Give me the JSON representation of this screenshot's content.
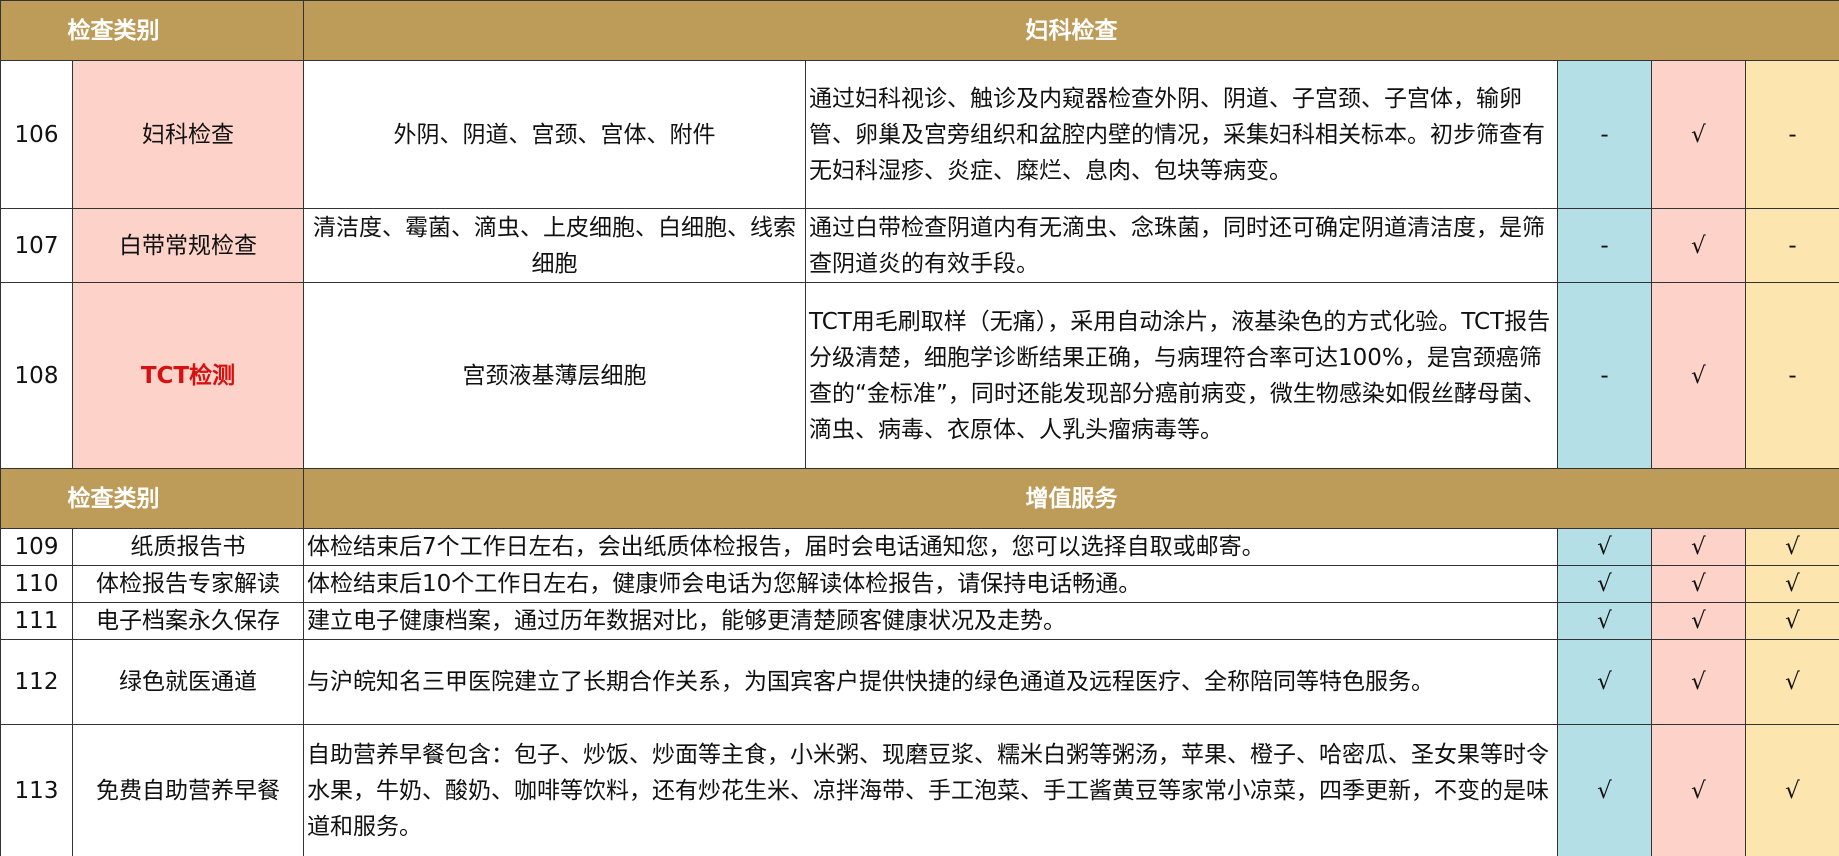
{
  "section1": {
    "category_label": "检查类别",
    "title": "妇科检查",
    "rows": [
      {
        "num": "106",
        "name": "妇科检查",
        "items": "外阴、阴道、宫颈、宫体、附件",
        "desc": "通过妇科视诊、触诊及内窥器检查外阴、阴道、子宫颈、子宫体，输卵管、卵巢及宫旁组织和盆腔内壁的情况，采集妇科相关标本。初步筛查有无妇科湿疹、炎症、糜烂、息肉、包块等病变。",
        "c1": "-",
        "c2": "√",
        "c3": "-"
      },
      {
        "num": "107",
        "name": "白带常规检查",
        "items": "清洁度、霉菌、滴虫、上皮细胞、白细胞、线索细胞",
        "desc": "通过白带检查阴道内有无滴虫、念珠菌，同时还可确定阴道清洁度，是筛查阴道炎的有效手段。",
        "c1": "-",
        "c2": "√",
        "c3": "-"
      },
      {
        "num": "108",
        "name": "TCT检测",
        "items": "宫颈液基薄层细胞",
        "desc": "TCT用毛刷取样（无痛），采用自动涂片，液基染色的方式化验。TCT报告分级清楚，细胞学诊断结果正确，与病理符合率可达100%，是宫颈癌筛查的“金标准”，同时还能发现部分癌前病变，微生物感染如假丝酵母菌、滴虫、病毒、衣原体、人乳头瘤病毒等。",
        "c1": "-",
        "c2": "√",
        "c3": "-"
      }
    ]
  },
  "section2": {
    "category_label": "检查类别",
    "title": "增值服务",
    "rows": [
      {
        "num": "109",
        "name": "纸质报告书",
        "desc": "体检结束后7个工作日左右，会出纸质体检报告，届时会电话通知您，您可以选择自取或邮寄。",
        "c1": "√",
        "c2": "√",
        "c3": "√"
      },
      {
        "num": "110",
        "name": "体检报告专家解读",
        "desc": "体检结束后10个工作日左右，健康师会电话为您解读体检报告，请保持电话畅通。",
        "c1": "√",
        "c2": "√",
        "c3": "√"
      },
      {
        "num": "111",
        "name": "电子档案永久保存",
        "desc": "建立电子健康档案，通过历年数据对比，能够更清楚顾客健康状况及走势。",
        "c1": "√",
        "c2": "√",
        "c3": "√"
      },
      {
        "num": "112",
        "name": "绿色就医通道",
        "desc": "与沪皖知名三甲医院建立了长期合作关系，为国宾客户提供快捷的绿色通道及远程医疗、全称陪同等特色服务。",
        "c1": "√",
        "c2": "√",
        "c3": "√"
      },
      {
        "num": "113",
        "name": "免费自助营养早餐",
        "desc": "自助营养早餐包含：包子、炒饭、炒面等主食，小米粥、现磨豆浆、糯米白粥等粥汤，苹果、橙子、哈密瓜、圣女果等时令水果，牛奶、酸奶、咖啡等饮料，还有炒花生米、凉拌海带、手工泡菜、手工酱黄豆等家常小凉菜，四季更新，不变的是味道和服务。",
        "c1": "√",
        "c2": "√",
        "c3": "√"
      }
    ]
  }
}
